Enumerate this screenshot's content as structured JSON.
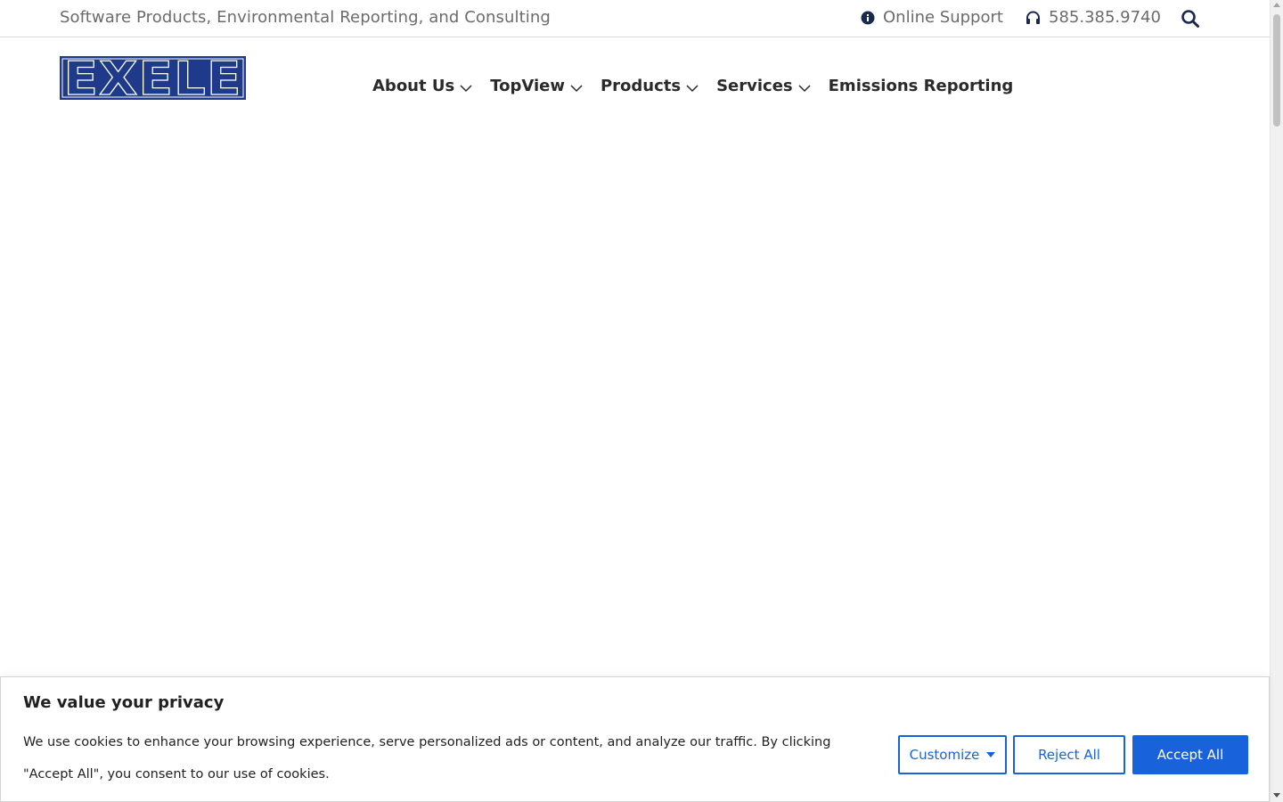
{
  "topbar": {
    "tagline": "Software Products, Environmental Reporting, and Consulting",
    "support_label": "Online Support",
    "phone": "585.385.9740"
  },
  "logo": {
    "text": "EXELE",
    "color": "#1f3a8a"
  },
  "nav": {
    "items": [
      {
        "label": "About Us",
        "has_dropdown": true
      },
      {
        "label": "TopView",
        "has_dropdown": true
      },
      {
        "label": "Products",
        "has_dropdown": true
      },
      {
        "label": "Services",
        "has_dropdown": true
      },
      {
        "label": "Emissions Reporting",
        "has_dropdown": false
      }
    ]
  },
  "cookie": {
    "title": "We value your privacy",
    "body": "We use cookies to enhance your browsing experience, serve personalized ads or content, and analyze our traffic. By clicking \"Accept All\", you consent to our use of cookies.",
    "customize_label": "Customize",
    "reject_label": "Reject All",
    "accept_label": "Accept All",
    "accent_color": "#1863dc"
  },
  "icons": {
    "support": "info-circle-icon",
    "phone": "headset-icon",
    "search": "search-icon",
    "dropdown": "chevron-down-icon"
  }
}
